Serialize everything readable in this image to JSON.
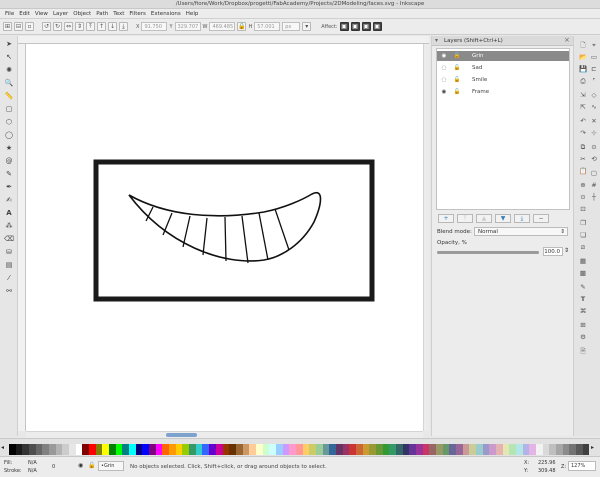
{
  "window": {
    "title": "/Users/fiore/Work/Dropbox/progetti/FabAcademy/Projects/2DModeling/faces.svg - Inkscape"
  },
  "menu": [
    "File",
    "Edit",
    "View",
    "Layer",
    "Object",
    "Path",
    "Text",
    "Filters",
    "Extensions",
    "Help"
  ],
  "controls": {
    "x_label": "X",
    "x_value": "91.750",
    "y_label": "Y",
    "y_value": "329.707",
    "w_label": "W",
    "w_value": "469.485",
    "h_label": "H",
    "h_value": "57.001",
    "unit": "px",
    "affect_label": "Affect:"
  },
  "layers_panel": {
    "title": "Layers (Shift+Ctrl+L)",
    "layers": [
      {
        "name": "Grin",
        "selected": true
      },
      {
        "name": "Sad",
        "selected": false
      },
      {
        "name": "Smile",
        "selected": false
      },
      {
        "name": "Frame",
        "selected": false
      }
    ],
    "blend_label": "Blend mode:",
    "blend_value": "Normal",
    "opacity_label": "Opacity, %",
    "opacity_value": "100.0",
    "opacity_fraction": 1.0
  },
  "status": {
    "fill_label": "Fill:",
    "fill_value": "N/A",
    "stroke_label": "Stroke:",
    "stroke_value": "N/A",
    "stroke_width": "0",
    "layer_select": "•Grin",
    "message": "No objects selected. Click, Shift+click, or drag around objects to select.",
    "x_label": "X:",
    "x_value": "225.96",
    "y_label": "Y:",
    "y_value": "309.48",
    "zoom_label": "Z:",
    "zoom_value": "127%"
  },
  "colors": {
    "selected_layer": "#8a8a8a",
    "accent": "#7da2ce",
    "palette": [
      "#000000",
      "#1a1a1a",
      "#333333",
      "#4d4d4d",
      "#666666",
      "#808080",
      "#999999",
      "#b3b3b3",
      "#cccccc",
      "#e6e6e6",
      "#ffffff",
      "#800000",
      "#ff0000",
      "#808000",
      "#ffff00",
      "#008000",
      "#00ff00",
      "#008080",
      "#00ffff",
      "#000080",
      "#0000ff",
      "#800080",
      "#ff00ff",
      "#ff6600",
      "#ff9900",
      "#ffcc00",
      "#99cc00",
      "#339966",
      "#33cccc",
      "#3366ff",
      "#6600cc",
      "#cc0099",
      "#993300",
      "#663300",
      "#996633",
      "#cc9966",
      "#ffcc99",
      "#ffffcc",
      "#ccffcc",
      "#ccffff",
      "#99ccff",
      "#cc99ff",
      "#ff99cc",
      "#ff9999",
      "#ffcc66",
      "#cccc66",
      "#99cc99",
      "#669999",
      "#336699",
      "#663366",
      "#993366",
      "#cc3333",
      "#cc6633",
      "#cc9933",
      "#999933",
      "#669933",
      "#339933",
      "#339966",
      "#336666",
      "#333366",
      "#663399",
      "#993399",
      "#cc3366",
      "#996666",
      "#999966",
      "#669966",
      "#666699",
      "#996699",
      "#cc9999",
      "#cccc99",
      "#99cccc",
      "#9999cc",
      "#cc99cc",
      "#e6b3b3",
      "#e6e6b3",
      "#b3e6b3",
      "#b3e6e6",
      "#b3b3e6",
      "#e6b3e6",
      "#f2f2f2",
      "#d9d9d9",
      "#bfbfbf",
      "#a6a6a6",
      "#8c8c8c",
      "#737373",
      "#595959",
      "#404040"
    ]
  }
}
